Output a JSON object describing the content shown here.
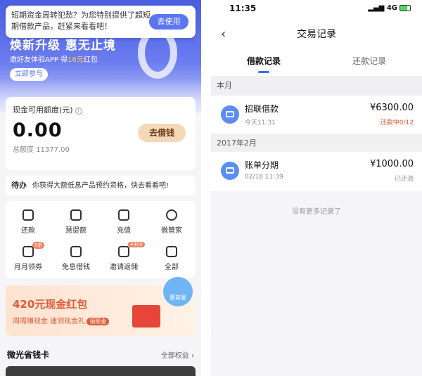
{
  "left": {
    "notice": {
      "text": "短期资金周转犯愁？为您特别提供了超短期借款产品，赶紧来看看吧！",
      "button": "去使用"
    },
    "banner": {
      "slogan": "焕新升级 惠无止境",
      "sub_prefix": "邀好友体验APP 得",
      "sub_highlight": "16元",
      "sub_suffix": "红包",
      "join": "立即参与"
    },
    "credit": {
      "label": "现金可用额度(元)",
      "info_icon": "info-icon",
      "amount": "0.00",
      "total": "总额度 11377.00",
      "borrow_button": "去借钱"
    },
    "todo": {
      "label": "待办",
      "text": "你获得大额低息产品预约资格，快去看看吧!"
    },
    "grid": [
      {
        "label": "还款",
        "icon": "repay-icon",
        "tag": ""
      },
      {
        "label": "慧提额",
        "icon": "raise-limit-icon",
        "tag": ""
      },
      {
        "label": "充值",
        "icon": "recharge-icon",
        "tag": ""
      },
      {
        "label": "微管家",
        "icon": "butler-icon",
        "tag": ""
      },
      {
        "label": "月月领券",
        "icon": "coupon-icon",
        "tag": "9折"
      },
      {
        "label": "免息借钱",
        "icon": "interest-free-icon",
        "tag": ""
      },
      {
        "label": "邀请返佣",
        "icon": "invite-icon",
        "tag": "¥400"
      },
      {
        "label": "全部",
        "icon": "more-icon",
        "tag": ""
      }
    ],
    "promo": {
      "title": "420元现金红包",
      "sub": "周周赚现金 速领现金礼",
      "badge": "领现金",
      "bubble": "惠商量"
    },
    "section": {
      "title": "微光省钱卡",
      "link": "全部权益"
    }
  },
  "right": {
    "status": {
      "time": "11:35",
      "network": "4G"
    },
    "nav": {
      "back": "‹",
      "title": "交易记录"
    },
    "tabs": [
      {
        "label": "借款记录",
        "active": true
      },
      {
        "label": "还款记录",
        "active": false
      }
    ],
    "sections": [
      {
        "title": "本月",
        "records": [
          {
            "name": "招联借款",
            "time": "今天11:31",
            "amount": "¥6300.00",
            "status": "还款中0/12",
            "status_color": "#e25a3a"
          }
        ]
      },
      {
        "title": "2017年2月",
        "records": [
          {
            "name": "账单分期",
            "time": "02/18 11:39",
            "amount": "¥1000.00",
            "status": "已还清",
            "status_color": "#999999"
          }
        ]
      }
    ],
    "empty_note": "没有更多记录了"
  }
}
